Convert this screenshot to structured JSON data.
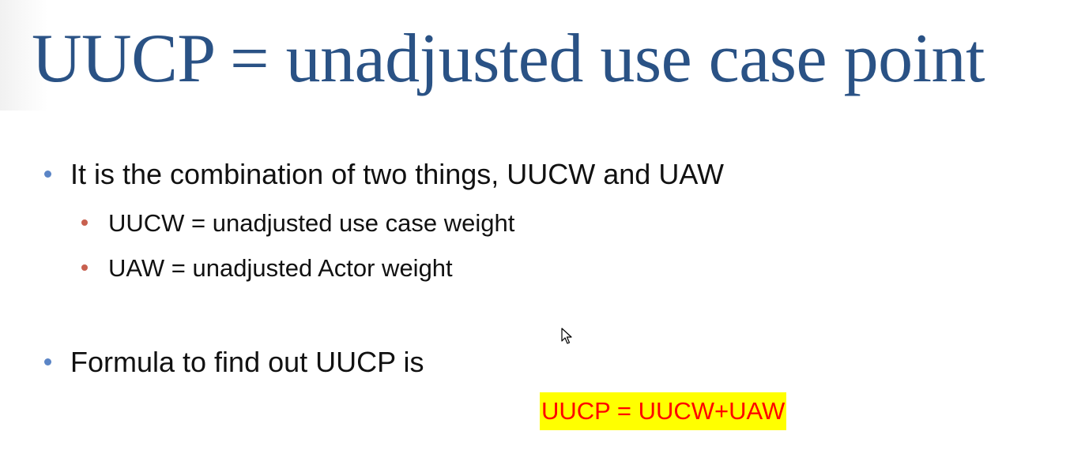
{
  "slide": {
    "title": "UUCP = unadjusted use case point",
    "bullets": [
      {
        "text": "It is the combination of two things, UUCW and UAW"
      },
      {
        "text": "UUCW = unadjusted use case weight"
      },
      {
        "text": "UAW = unadjusted Actor weight"
      },
      {
        "text": "Formula to find out UUCP is"
      }
    ],
    "formula": "UUCP = UUCW+UAW"
  },
  "colors": {
    "title": "#2a5285",
    "bullet_level1": "#5b85c6",
    "bullet_level2": "#c8604f",
    "formula_text": "#ff0000",
    "formula_highlight": "#ffff00"
  },
  "icons": {
    "cursor": "mouse-pointer-icon"
  }
}
